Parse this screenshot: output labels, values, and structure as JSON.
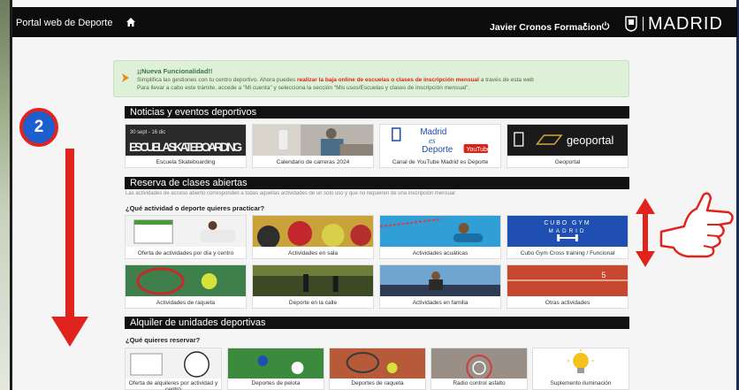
{
  "header": {
    "brand": "Portal web de Deporte",
    "user": "Javier Cronos Formacion",
    "logo": "MADRID",
    "icons": [
      "home-icon",
      "power-icon",
      "madrid-shield-icon"
    ]
  },
  "notice": {
    "title": "¡¡Nueva Funcionalidad!!",
    "line1_pre": "Simplifica las gestiones con tu centro deportivo. Ahora puedes ",
    "line1_highlight": "realizar la baja online de escuelas o clases de inscripción mensual",
    "line1_post": " a través de esta web",
    "line2": "Para llevar a cabo este trámite, accede a \"Mi cuenta\" y selecciona la sección \"Mis usos/Escuelas y clases de inscripción mensual\"."
  },
  "sections": {
    "news": "Noticias y eventos deportivos",
    "classes": "Reserva de clases abiertas",
    "classes_note": "Las actividades de acceso abierto corresponden a todas aquellas actividades de un solo uso y que no requieren de una inscripción mensual",
    "classes_question": "¿Qué actividad o deporte quieres practicar?",
    "rentals": "Alquiler de unidades deportivas",
    "rentals_question": "¿Qué quieres reservar?"
  },
  "news_cards": [
    {
      "label": "Escuela Skateboarding",
      "art": "ESCUELA SKATEBOARDING",
      "art_top": "30 sept - 16 dic"
    },
    {
      "label": "Calendario de carreras 2024"
    },
    {
      "label": "Canal de YouTube Madrid es Deporte",
      "art1": "Madrid",
      "art2": "es",
      "art3": "Deporte",
      "art4": "YouTube"
    },
    {
      "label": "Geoportal",
      "art": "geoportal"
    }
  ],
  "activity_cards": [
    {
      "label": "Oferta de actividades por día y centro"
    },
    {
      "label": "Actividades en sala"
    },
    {
      "label": "Actividades acuáticas"
    },
    {
      "label": "Cubo Gym Cross training / Funcional",
      "art1": "CUBO GYM",
      "art2": "MADRID"
    },
    {
      "label": "Actividades de raqueta"
    },
    {
      "label": "Deporte en la calle"
    },
    {
      "label": "Actividades en familia"
    },
    {
      "label": "Otras actividades",
      "art": "5"
    }
  ],
  "rental_cards": [
    {
      "label": "Oferta de alquileres por actividad y centro"
    },
    {
      "label": "Deportes de pelota"
    },
    {
      "label": "Deportes de raqueta"
    },
    {
      "label": "Radio control asfalto"
    },
    {
      "label": "Suplemento iluminación"
    }
  ],
  "overlay": {
    "step": "2"
  },
  "colors": {
    "topbar": "#0c0c0c",
    "section_bar": "#111111",
    "notice_bg": "#dff0d8",
    "highlight_red": "#d9261c",
    "badge_blue": "#1d5fcf",
    "annotation_red": "#e0231c"
  }
}
